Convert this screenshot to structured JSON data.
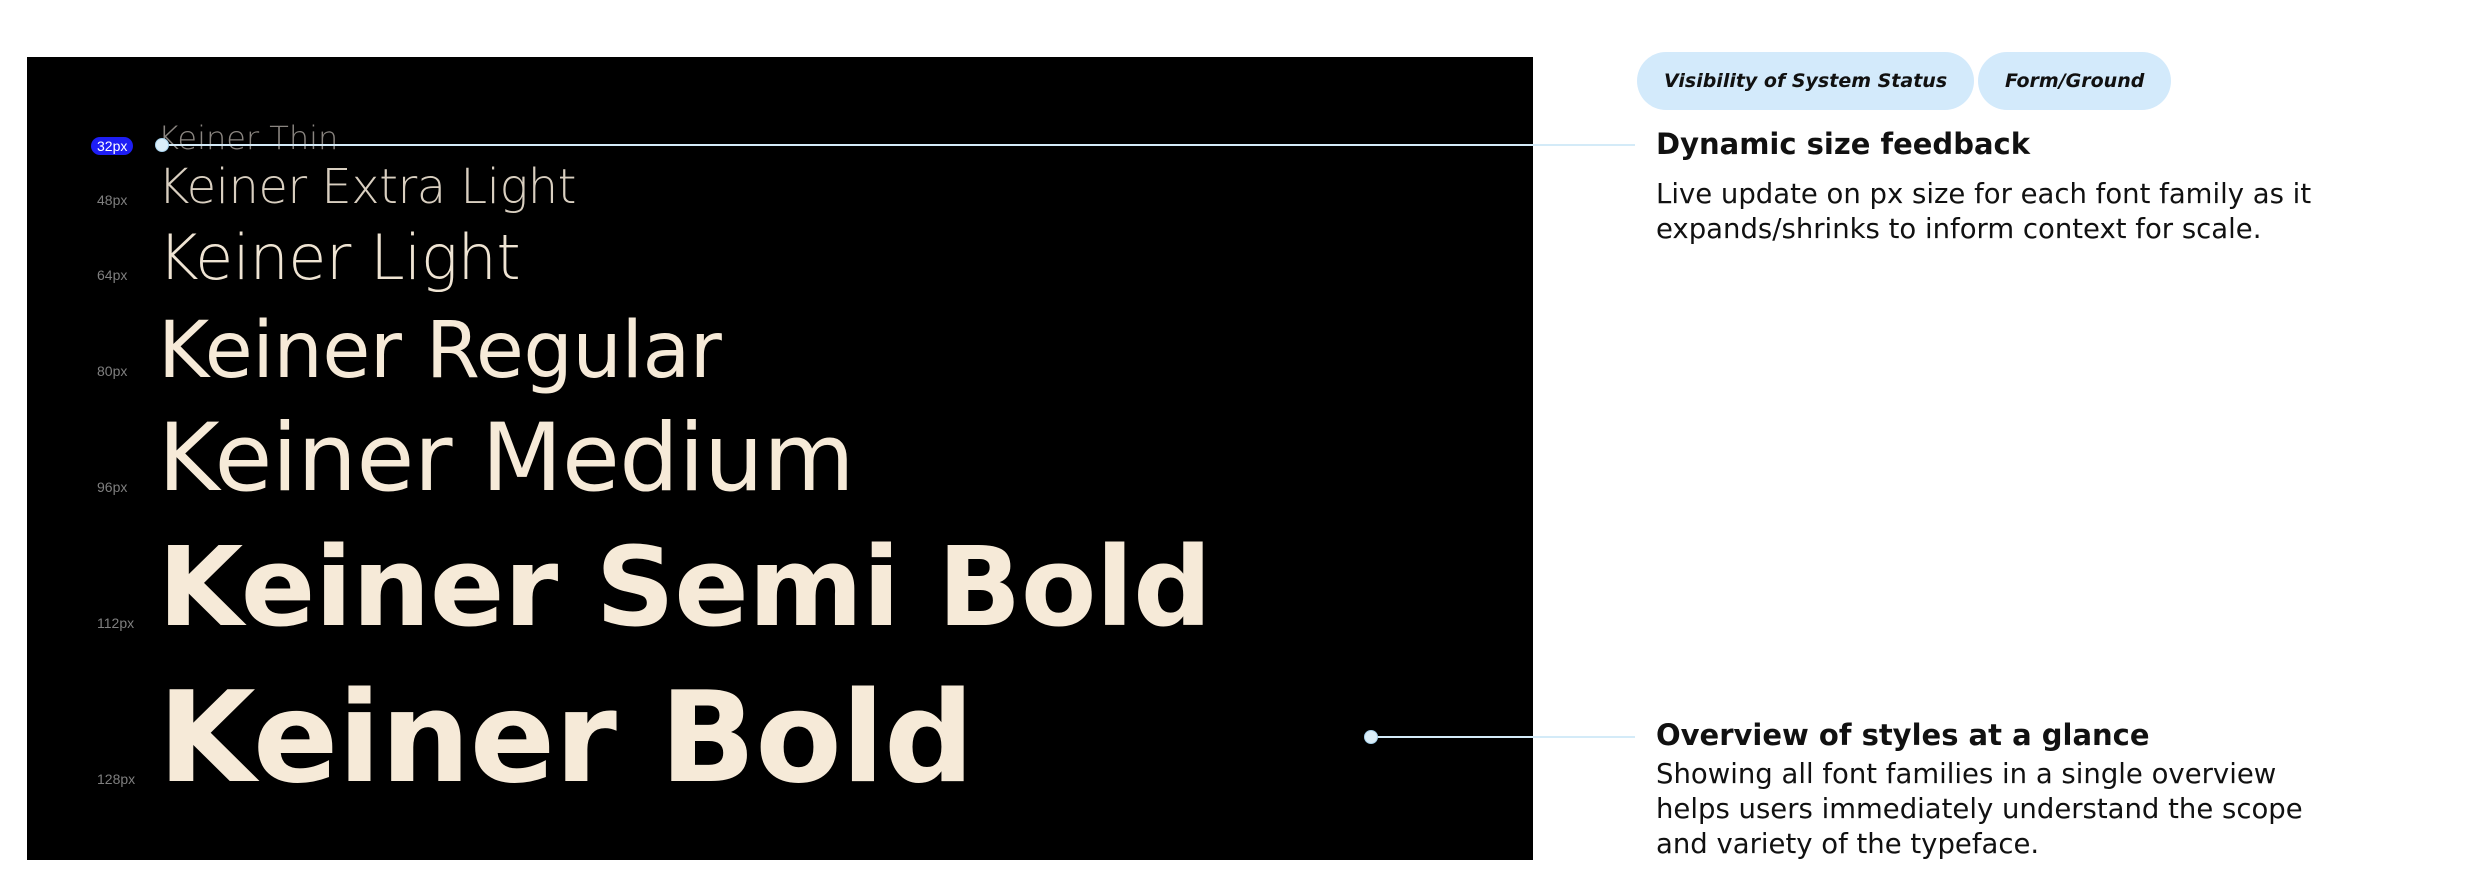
{
  "specimen": {
    "rows": [
      {
        "size": "32px",
        "name": "Keiner Thin"
      },
      {
        "size": "48px",
        "name": "Keiner Extra Light"
      },
      {
        "size": "64px",
        "name": "Keiner Light"
      },
      {
        "size": "80px",
        "name": "Keiner Regular"
      },
      {
        "size": "96px",
        "name": "Keiner Medium"
      },
      {
        "size": "112px",
        "name": "Keiner Semi Bold"
      },
      {
        "size": "128px",
        "name": "Keiner Bold"
      }
    ]
  },
  "tags": [
    "Visibility of System Status",
    "Form/Ground"
  ],
  "annotations": [
    {
      "title": "Dynamic size feedback",
      "lines": [
        "Live update on px size for each font family as it",
        "expands/shrinks to inform context for scale."
      ]
    },
    {
      "title": "Overview of styles at a glance",
      "lines": [
        "Showing all font families in a single overview",
        "helps users immediately understand the scope",
        "and variety of the typeface."
      ]
    }
  ],
  "colors": {
    "panel_background": "#000000",
    "type_color": "#f6ead8",
    "active_size_highlight": "#1e1ef5",
    "tag_background": "#d3eafb",
    "leader_line": "#d4ebf8"
  }
}
